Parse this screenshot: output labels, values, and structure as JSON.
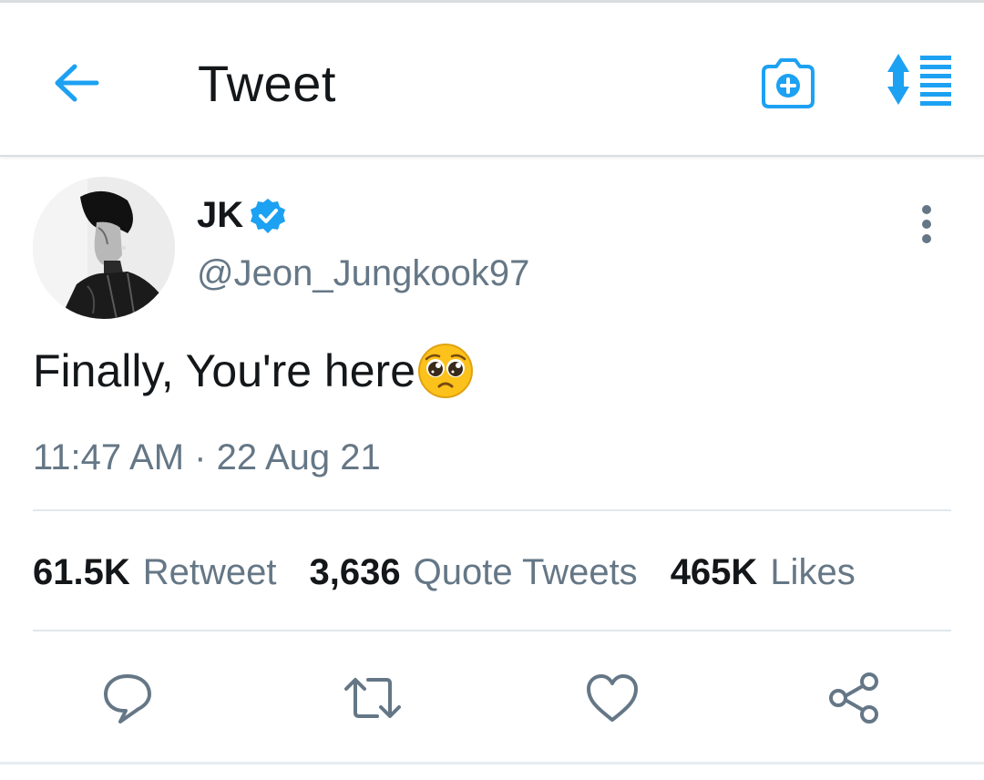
{
  "header": {
    "title": "Tweet",
    "back_icon": "arrow-left-icon",
    "camera_icon": "camera-plus-icon",
    "sort_icon": "sort-list-icon",
    "accent_color": "#1da1f2"
  },
  "tweet": {
    "display_name": "JK",
    "verified": true,
    "handle": "@Jeon_Jungkook97",
    "text": "Finally, You're here",
    "emoji": "pleading-face",
    "time": "11:47 AM",
    "separator": " · ",
    "date": "22 Aug 21"
  },
  "stats": [
    {
      "count": "61.5K",
      "label": "Retweet"
    },
    {
      "count": "3,636",
      "label": "Quote Tweets"
    },
    {
      "count": "465K",
      "label": "Likes"
    }
  ],
  "actions": [
    "reply-icon",
    "retweet-icon",
    "like-icon",
    "share-icon"
  ],
  "colors": {
    "text_primary": "#14171a",
    "text_secondary": "#657786",
    "icon_gray": "#657786",
    "divider": "#e1e8ed"
  }
}
